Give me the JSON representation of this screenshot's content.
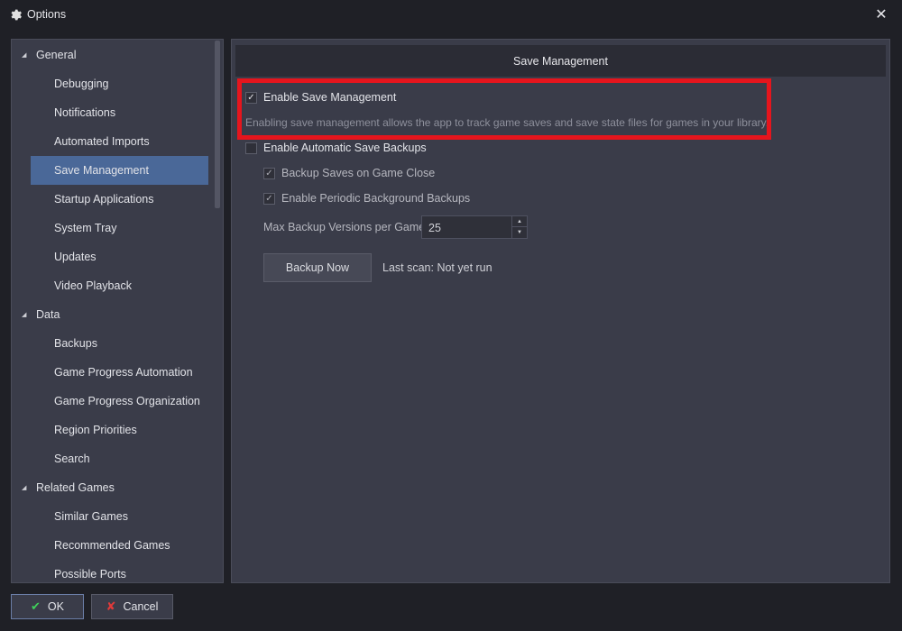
{
  "window": {
    "title": "Options",
    "icon": "gear-icon",
    "close_icon": "close-icon"
  },
  "sidebar": {
    "groups": [
      {
        "label": "General",
        "items": [
          "Debugging",
          "Notifications",
          "Automated Imports",
          "Save Management",
          "Startup Applications",
          "System Tray",
          "Updates",
          "Video Playback"
        ]
      },
      {
        "label": "Data",
        "items": [
          "Backups",
          "Game Progress Automation",
          "Game Progress Organization",
          "Region Priorities",
          "Search"
        ]
      },
      {
        "label": "Related Games",
        "items": [
          "Similar Games",
          "Recommended Games",
          "Possible Ports"
        ]
      }
    ],
    "selected": "Save Management"
  },
  "panel": {
    "header": "Save Management",
    "enable_save_management": {
      "label": "Enable Save Management",
      "checked": true
    },
    "enable_hint": "Enabling save management allows the app to track game saves and save state files for games in your library.",
    "enable_auto_backups": {
      "label": "Enable Automatic Save Backups",
      "checked": false
    },
    "backup_on_close": {
      "label": "Backup Saves on Game Close",
      "checked": true
    },
    "periodic_backups": {
      "label": "Enable Periodic Background Backups",
      "checked": true
    },
    "max_versions": {
      "label": "Max Backup Versions per Game",
      "value": "25"
    },
    "backup_now_label": "Backup Now",
    "last_scan": "Last scan: Not yet run"
  },
  "footer": {
    "ok_label": "OK",
    "cancel_label": "Cancel"
  },
  "colors": {
    "highlight": "#e5151d",
    "selection": "#4a6898",
    "ok_icon": "#3fd05a",
    "cancel_icon": "#e03a3a"
  }
}
